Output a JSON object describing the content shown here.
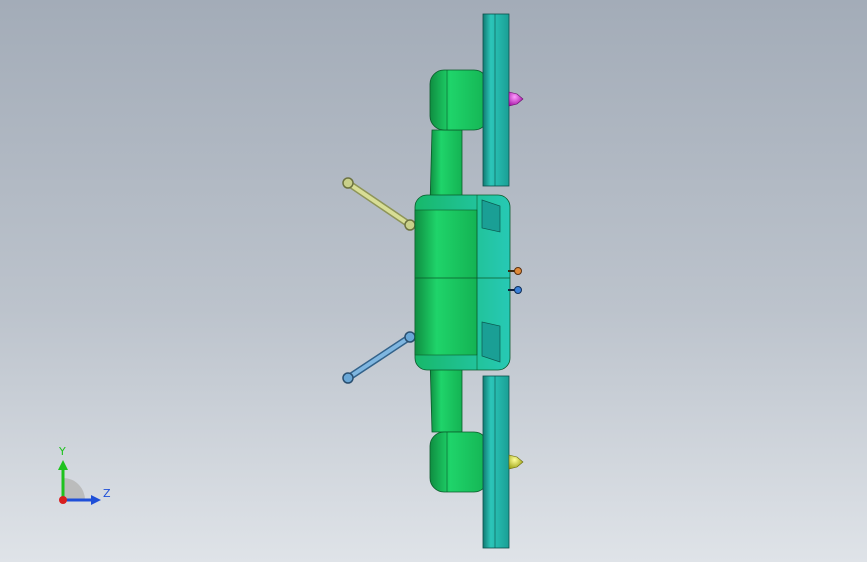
{
  "viewport": {
    "background_top": "#a3acb8",
    "background_bottom": "#dfe3e8"
  },
  "model": {
    "body_color": "#17c35c",
    "body_dark": "#0f8e41",
    "disc_color": "#22b3a7",
    "disc_dark": "#117a73",
    "cap_magenta": "#cc22cc",
    "cap_yellow": "#d8d820",
    "arm_upper_color": "#c9d08a",
    "arm_lower_color": "#6aa7d6",
    "marker_orange": "#e08a3a",
    "marker_blue": "#3a7fd8"
  },
  "triad": {
    "y_label": "Y",
    "z_label": "Z",
    "y_color": "#1ec21e",
    "z_color": "#1f4fd8",
    "x_color": "#d81f1f",
    "icon": "view-orientation-triad-icon"
  }
}
